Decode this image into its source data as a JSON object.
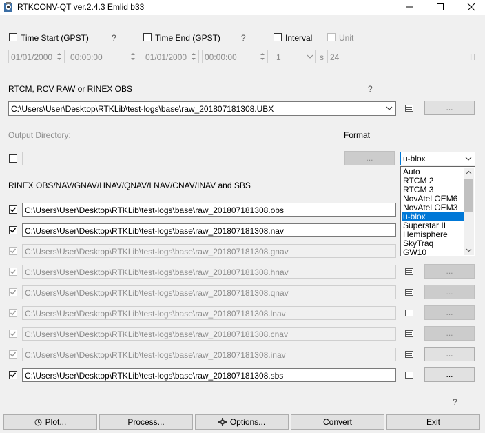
{
  "window": {
    "title": "RTKCONV-QT ver.2.4.3 Emlid b33",
    "minimize": "—",
    "maximize": "☐",
    "close": "✕"
  },
  "time": {
    "start_label": "Time Start (GPST)",
    "start_help": "?",
    "end_label": "Time End (GPST)",
    "end_help": "?",
    "interval_label": "Interval",
    "unit_label": "Unit",
    "start_date": "01/01/2000",
    "start_time": "00:00:00",
    "end_date": "01/01/2000",
    "end_time": "00:00:00",
    "interval_value": "1",
    "interval_unit": "s",
    "unit_value": "24",
    "unit_suffix": "H"
  },
  "input": {
    "label": "RTCM, RCV RAW or RINEX OBS",
    "help": "?",
    "path": "C:\\Users\\User\\Desktop\\RTKLib\\test-logs\\base\\raw_201807181308.UBX",
    "browse": "..."
  },
  "output_dir": {
    "label": "Output Directory:",
    "browse": "...",
    "path": ""
  },
  "format": {
    "label": "Format",
    "selected": "u-blox",
    "options": [
      "Auto",
      "RTCM 2",
      "RTCM 3",
      "NovAtel OEM6",
      "NovAtel OEM3",
      "u-blox",
      "Superstar II",
      "Hemisphere",
      "SkyTraq",
      "GW10"
    ]
  },
  "rinex": {
    "label": "RINEX OBS/NAV/GNAV/HNAV/QNAV/LNAV/CNAV/INAV and SBS",
    "rows": [
      {
        "path": "C:\\Users\\User\\Desktop\\RTKLib\\test-logs\\base\\raw_201807181308.obs",
        "enabled": true
      },
      {
        "path": "C:\\Users\\User\\Desktop\\RTKLib\\test-logs\\base\\raw_201807181308.nav",
        "enabled": true
      },
      {
        "path": "C:\\Users\\User\\Desktop\\RTKLib\\test-logs\\base\\raw_201807181308.gnav",
        "enabled": false
      },
      {
        "path": "C:\\Users\\User\\Desktop\\RTKLib\\test-logs\\base\\raw_201807181308.hnav",
        "enabled": false
      },
      {
        "path": "C:\\Users\\User\\Desktop\\RTKLib\\test-logs\\base\\raw_201807181308.qnav",
        "enabled": false
      },
      {
        "path": "C:\\Users\\User\\Desktop\\RTKLib\\test-logs\\base\\raw_201807181308.lnav",
        "enabled": false
      },
      {
        "path": "C:\\Users\\User\\Desktop\\RTKLib\\test-logs\\base\\raw_201807181308.cnav",
        "enabled": false
      },
      {
        "path": "C:\\Users\\User\\Desktop\\RTKLib\\test-logs\\base\\raw_201807181308.inav",
        "enabled": false
      },
      {
        "path": "C:\\Users\\User\\Desktop\\RTKLib\\test-logs\\base\\raw_201807181308.sbs",
        "enabled": true
      }
    ],
    "browse": "..."
  },
  "footer": {
    "help": "?",
    "plot": "Plot...",
    "process": "Process...",
    "options": "Options...",
    "convert": "Convert",
    "exit": "Exit"
  },
  "colors": {
    "selection": "#0078d7",
    "window_bg": "#f0f0f0"
  }
}
